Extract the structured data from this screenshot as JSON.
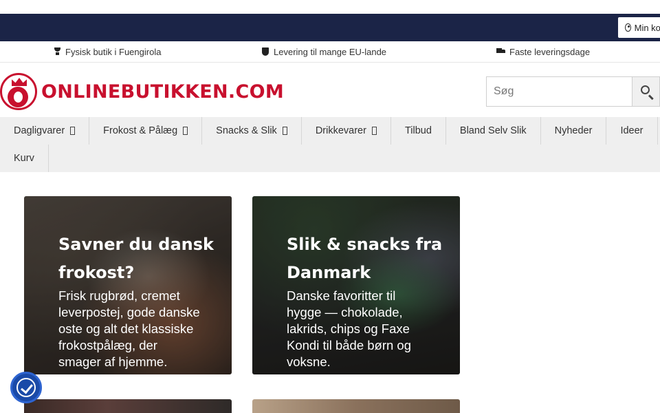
{
  "topbar": {
    "account_label": "Min konto",
    "background_color": "#1b2447"
  },
  "infobar": {
    "items": [
      {
        "icon": "trophy-icon",
        "label": "Fysisk butik i Fuengirola"
      },
      {
        "icon": "shield-icon",
        "label": "Levering til mange EU-lande"
      },
      {
        "icon": "truck-icon",
        "label": "Faste leveringsdage"
      }
    ]
  },
  "header": {
    "logo_text": "ONLINEBUTIKKEN.COM",
    "brand_color": "#c8102e",
    "search": {
      "placeholder": "Søg",
      "button_icon": "search-icon"
    }
  },
  "nav": {
    "row1": [
      {
        "label": "Dagligvarer",
        "has_dropdown": true
      },
      {
        "label": "Frokost & Pålæg",
        "has_dropdown": true
      },
      {
        "label": "Snacks & Slik",
        "has_dropdown": true
      },
      {
        "label": "Drikkevarer",
        "has_dropdown": true
      },
      {
        "label": "Tilbud",
        "has_dropdown": false
      },
      {
        "label": "Bland Selv Slik",
        "has_dropdown": false
      },
      {
        "label": "Nyheder",
        "has_dropdown": false
      },
      {
        "label": "Ideer",
        "has_dropdown": false
      }
    ],
    "row2": [
      {
        "label": "Kurv",
        "has_dropdown": false
      }
    ]
  },
  "cards": [
    {
      "title": "Savner du dansk frokost?",
      "text": "Frisk rugbrød, cremet leverpostej, gode danske oste og alt det klassiske frokostpålæg, der smager af hjemme."
    },
    {
      "title": "Slik & snacks fra Danmark",
      "text": "Danske favoritter til hygge — chokolade, lakrids, chips og Faxe Kondi til både børn og voksne."
    }
  ],
  "consent": {
    "icon": "cookie-consent-icon",
    "color": "#1a4aa8"
  }
}
